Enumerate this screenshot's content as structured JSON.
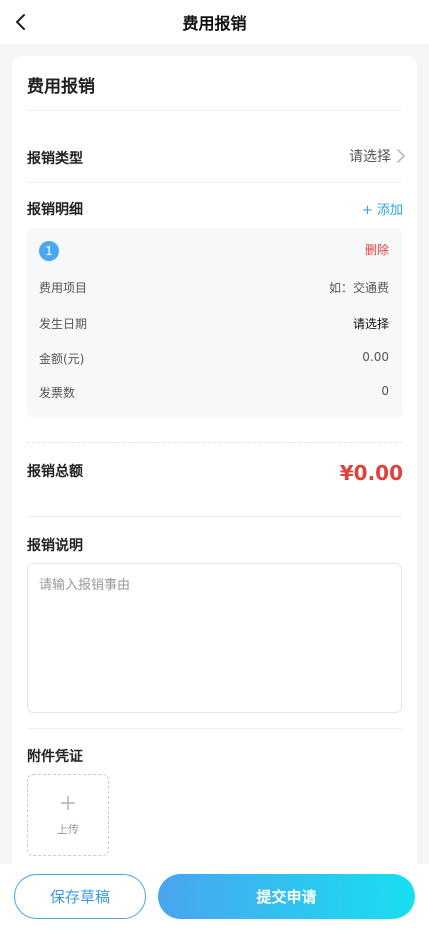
{
  "nav": {
    "title": "费用报销",
    "back_icon": "chevron-left-icon"
  },
  "form": {
    "title": "费用报销",
    "type": {
      "label": "报销类型",
      "value": "请选择"
    },
    "details": {
      "label": "报销明细",
      "add_label": "+ 添加",
      "items": [
        {
          "index": "1",
          "delete_label": "删除",
          "fields": [
            {
              "label": "费用项目",
              "value": "如：交通费"
            },
            {
              "label": "发生日期",
              "value": "请选择"
            },
            {
              "label": "金额(元)",
              "value": "0.00"
            },
            {
              "label": "发票数",
              "value": "0"
            }
          ]
        }
      ]
    },
    "total": {
      "label": "报销总额",
      "value": "¥0.00"
    },
    "description": {
      "label": "报销说明",
      "placeholder": "请输入报销事由"
    },
    "attachments": {
      "label": "附件凭证",
      "upload_label": "上传"
    }
  },
  "actions": {
    "draft_label": "保存草稿",
    "submit_label": "提交申请"
  },
  "colors": {
    "accent": "#4aa4ef",
    "danger": "#e0413a",
    "gradient_end": "#17dff0"
  }
}
